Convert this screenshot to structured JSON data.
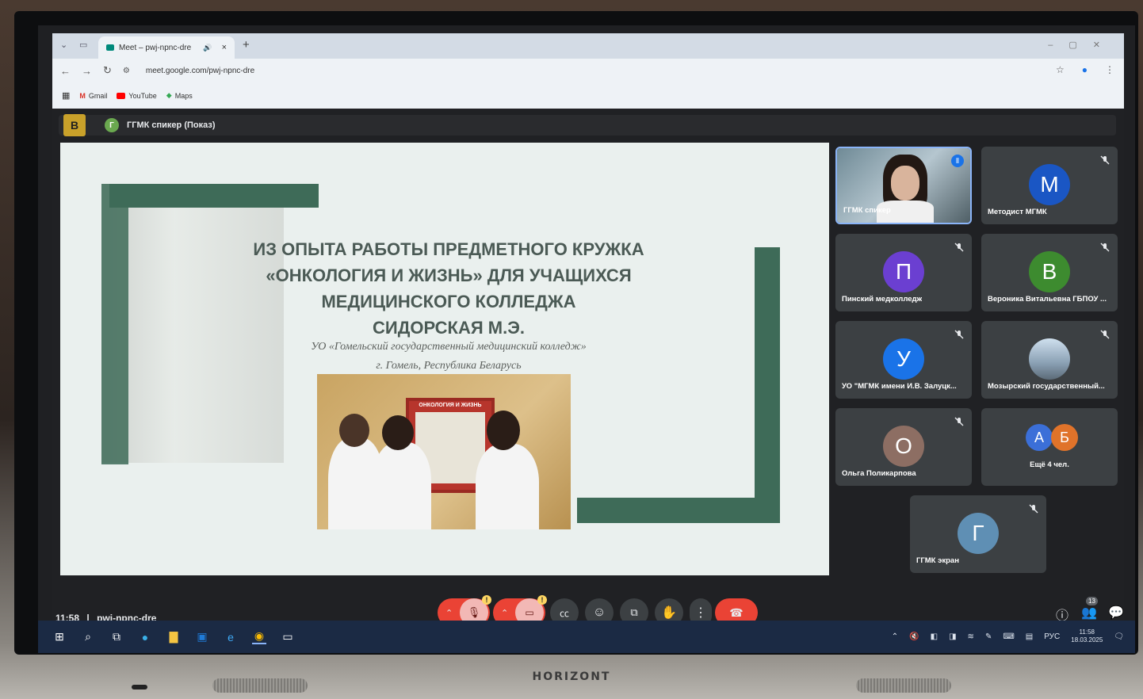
{
  "browser": {
    "tab_title": "Meet – pwj-npnc-dre",
    "tab_close": "×",
    "new_tab": "+",
    "url": "meet.google.com/pwj-npnc-dre",
    "bookmarks": [
      {
        "label": "Gmail",
        "icon": "gmail-icon",
        "color": "#d93025"
      },
      {
        "label": "YouTube",
        "icon": "youtube-icon",
        "color": "#ff0000"
      },
      {
        "label": "Maps",
        "icon": "maps-icon",
        "color": "#34a853"
      }
    ]
  },
  "presenter": {
    "badge": "В",
    "avatar_letter": "Г",
    "label": "ГГМК спикер (Показ)"
  },
  "slide": {
    "title_lines": [
      "ИЗ ОПЫТА РАБОТЫ ПРЕДМЕТНОГО КРУЖКА",
      "«ОНКОЛОГИЯ И ЖИЗНЬ» ДЛЯ УЧАЩИХСЯ",
      "МЕДИЦИНСКОГО КОЛЛЕДЖА",
      "СИДОРСКАЯ М.Э."
    ],
    "subtitle_lines": [
      "УО «Гомельский государственный медицинский колледж»",
      "г. Гомель, Республика Беларусь"
    ],
    "photo_board_text": "ОНКОЛОГИЯ И ЖИЗНЬ"
  },
  "participants": [
    {
      "name": "ГГМК спикер",
      "letter": "",
      "color": "#7a8a90",
      "video": true,
      "speaking": true
    },
    {
      "name": "Методист МГМК",
      "letter": "М",
      "color": "#1a56c4"
    },
    {
      "name": "Пинский медколледж",
      "letter": "П",
      "color": "#6b3fd1"
    },
    {
      "name": "Вероника Витальевна ГБПОУ ...",
      "letter": "В",
      "color": "#3d8b2f"
    },
    {
      "name": "УО \"МГМК имени И.В. Залуцк...",
      "letter": "У",
      "color": "#1a73e8"
    },
    {
      "name": "Мозырский государственный...",
      "letter": "",
      "color": "#9fb4c8",
      "photo": true
    },
    {
      "name": "Ольга Поликарпова",
      "letter": "О",
      "color": "#8d6e63"
    },
    {
      "name": "Ещё 4 чел.",
      "letters": [
        "А",
        "Б"
      ],
      "colors": [
        "#3b6fd8",
        "#e0732a"
      ]
    },
    {
      "name": "ГГМК экран",
      "letter": "Г",
      "color": "#5f8fb4"
    }
  ],
  "bottom": {
    "time": "11:58",
    "separator": "|",
    "meeting_code": "pwj-npnc-dre",
    "people_count": "13"
  },
  "taskbar": {
    "lang": "РУС",
    "time": "11:58",
    "date": "18.03.2025"
  }
}
